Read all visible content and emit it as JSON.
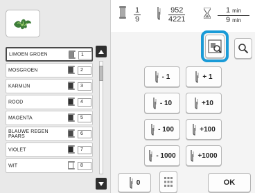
{
  "counters": {
    "color_current": "1",
    "color_total": "9",
    "stitch_current": "952",
    "stitch_total": "4221",
    "time_current": "1",
    "time_current_unit": "min",
    "time_total": "9",
    "time_total_unit": "min"
  },
  "colors": {
    "accent_highlight": "#1a9bd7",
    "dark_button": "#2e2e2e"
  },
  "thread_list": [
    {
      "name": "LIMOEN GROEN",
      "number": "1",
      "spool_color": "#8a8a8a",
      "selected": true
    },
    {
      "name": "MOSGROEN",
      "number": "2",
      "spool_color": "#4a4a4a",
      "selected": false
    },
    {
      "name": "KARMIJN",
      "number": "3",
      "spool_color": "#3a3a3a",
      "selected": false
    },
    {
      "name": "ROOD",
      "number": "4",
      "spool_color": "#2f2f2f",
      "selected": false
    },
    {
      "name": "MAGENTA",
      "number": "5",
      "spool_color": "#3a3a3a",
      "selected": false
    },
    {
      "name": "BLAUWE REGEN PAARS",
      "number": "6",
      "spool_color": "#4a4a4a",
      "selected": false
    },
    {
      "name": "VIOLET",
      "number": "7",
      "spool_color": "#2a2a2a",
      "selected": false
    },
    {
      "name": "WIT",
      "number": "8",
      "spool_color": "#ffffff",
      "selected": false
    }
  ],
  "stitch_buttons": [
    {
      "icon": "needle-icon",
      "label": "- 1"
    },
    {
      "icon": "needle-icon",
      "label": "+ 1"
    },
    {
      "icon": "needle-icon",
      "label": "- 10"
    },
    {
      "icon": "needle-icon",
      "label": "+10"
    },
    {
      "icon": "needle-icon",
      "label": "- 100"
    },
    {
      "icon": "needle-icon",
      "label": "+100"
    },
    {
      "icon": "needle-icon",
      "label": "- 1000"
    },
    {
      "icon": "needle-icon",
      "label": "+1000"
    }
  ],
  "bottom": {
    "zero_label": "0",
    "ok_label": "OK"
  },
  "icons": {
    "preview": "embroidery-preview-icon",
    "jump": "jump-to-position-icon",
    "magnify": "magnify-icon",
    "spool": "thread-spool-icon",
    "hourglass": "hourglass-icon",
    "grid": "grid-icon",
    "scroll_up": "triangle-up-icon",
    "scroll_down": "triangle-down-icon"
  }
}
